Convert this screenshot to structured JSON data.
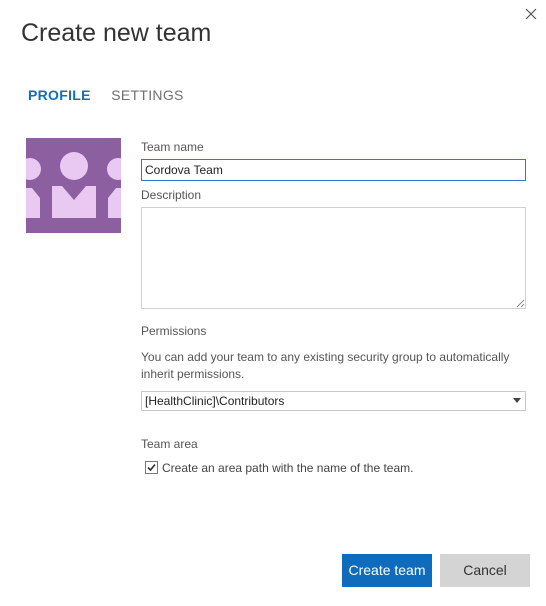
{
  "dialog": {
    "title": "Create new team",
    "close_icon": "close-icon"
  },
  "tabs": [
    {
      "label": "PROFILE",
      "active": true
    },
    {
      "label": "SETTINGS",
      "active": false
    }
  ],
  "avatar": {
    "icon": "team-avatar-icon",
    "bg_color": "#8b5fa0",
    "fg_color": "#e9c8f2"
  },
  "form": {
    "team_name_label": "Team name",
    "team_name_value": "Cordova Team",
    "description_label": "Description",
    "description_value": "",
    "permissions_label": "Permissions",
    "permissions_help": "You can add your team to any existing security group to automatically inherit permissions.",
    "permissions_selected": "[HealthClinic]\\Contributors",
    "team_area_label": "Team area",
    "area_checkbox_label": "Create an area path with the name of the team.",
    "area_checkbox_checked": true
  },
  "buttons": {
    "create_label": "Create team",
    "cancel_label": "Cancel"
  },
  "colors": {
    "accent": "#0f6cbd",
    "tab_active": "#106ebe"
  }
}
